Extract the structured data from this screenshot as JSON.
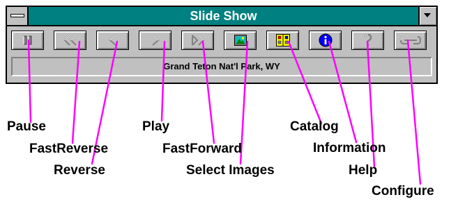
{
  "window": {
    "title": "Slide Show",
    "status": "Grand Teton Nat'l Park, WY"
  },
  "toolbar": {
    "buttons": [
      {
        "name": "pause-button",
        "icon": "pause-icon"
      },
      {
        "name": "fast-reverse-button",
        "icon": "fast-reverse-icon"
      },
      {
        "name": "reverse-button",
        "icon": "reverse-icon"
      },
      {
        "name": "play-button",
        "icon": "play-icon"
      },
      {
        "name": "fast-forward-button",
        "icon": "fast-forward-icon"
      },
      {
        "name": "select-images-button",
        "icon": "picture-icon"
      },
      {
        "name": "catalog-button",
        "icon": "catalog-icon"
      },
      {
        "name": "information-button",
        "icon": "info-icon"
      },
      {
        "name": "help-button",
        "icon": "help-icon"
      },
      {
        "name": "configure-button",
        "icon": "configure-icon"
      }
    ]
  },
  "callouts": {
    "pause": "Pause",
    "fast_reverse": "FastReverse",
    "reverse": "Reverse",
    "play": "Play",
    "fast_forward": "FastForward",
    "select_images": "Select Images",
    "catalog": "Catalog",
    "information": "Information",
    "help": "Help",
    "configure": "Configure"
  },
  "colors": {
    "title_bar": "#008080",
    "face": "#c0c0c0",
    "leader_lines": "#ff00ff",
    "info_icon": "#0000ff",
    "catalog_icon": "#ffff00",
    "picture_icon": "#00c0c0"
  }
}
